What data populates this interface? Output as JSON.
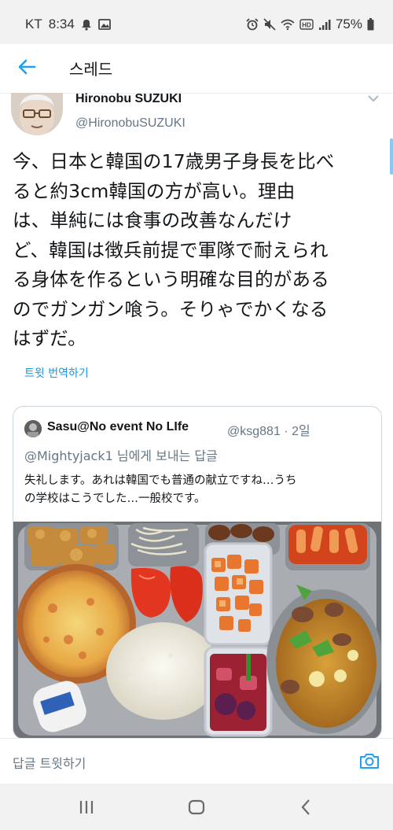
{
  "status_bar": {
    "carrier": "KT",
    "time": "8:34",
    "battery": "75%",
    "icons_left": [
      "notification-icon",
      "gallery-icon"
    ],
    "icons_right": [
      "alarm-icon",
      "mute-icon",
      "wifi-icon",
      "hd-icon",
      "signal-icon",
      "battery-icon"
    ]
  },
  "header": {
    "title": "스레드",
    "back_icon": "back-arrow-icon",
    "accent_color": "#1da1f2"
  },
  "tweet": {
    "author_name": "Hironobu SUZUKI",
    "author_handle": "@HironobuSUZUKI",
    "text": "今、日本と韓国の17歳男子身長を比べ\nると約3cm韓国の方が高い。理由\nは、単純には食事の改善なんだけ\nど、韓国は徴兵前提で軍隊で耐えられ\nる身体を作るという明確な目的がある\nのでガンガン喰う。そりゃでかくなる\nはずだ。",
    "translate_label": "트윗 번역하기"
  },
  "quoted_tweet": {
    "author_name": "Sasu@No event No LIfe",
    "author_handle": "@ksg881",
    "time_ago": "2일",
    "reply_mention": "@Mightyjack1",
    "reply_suffix": " 님에게 보내는 답글",
    "text": "失礼します。あれは韓国でも普通の献立ですね…うち\nの学校はこうでした…一般校です。",
    "image_description_icon": "school-lunch-tray-photo"
  },
  "reply_bar": {
    "placeholder": "답글 트윗하기",
    "camera_icon": "camera-icon"
  },
  "nav_bar": {
    "icons": [
      "recent-apps-icon",
      "home-icon",
      "back-icon"
    ]
  }
}
